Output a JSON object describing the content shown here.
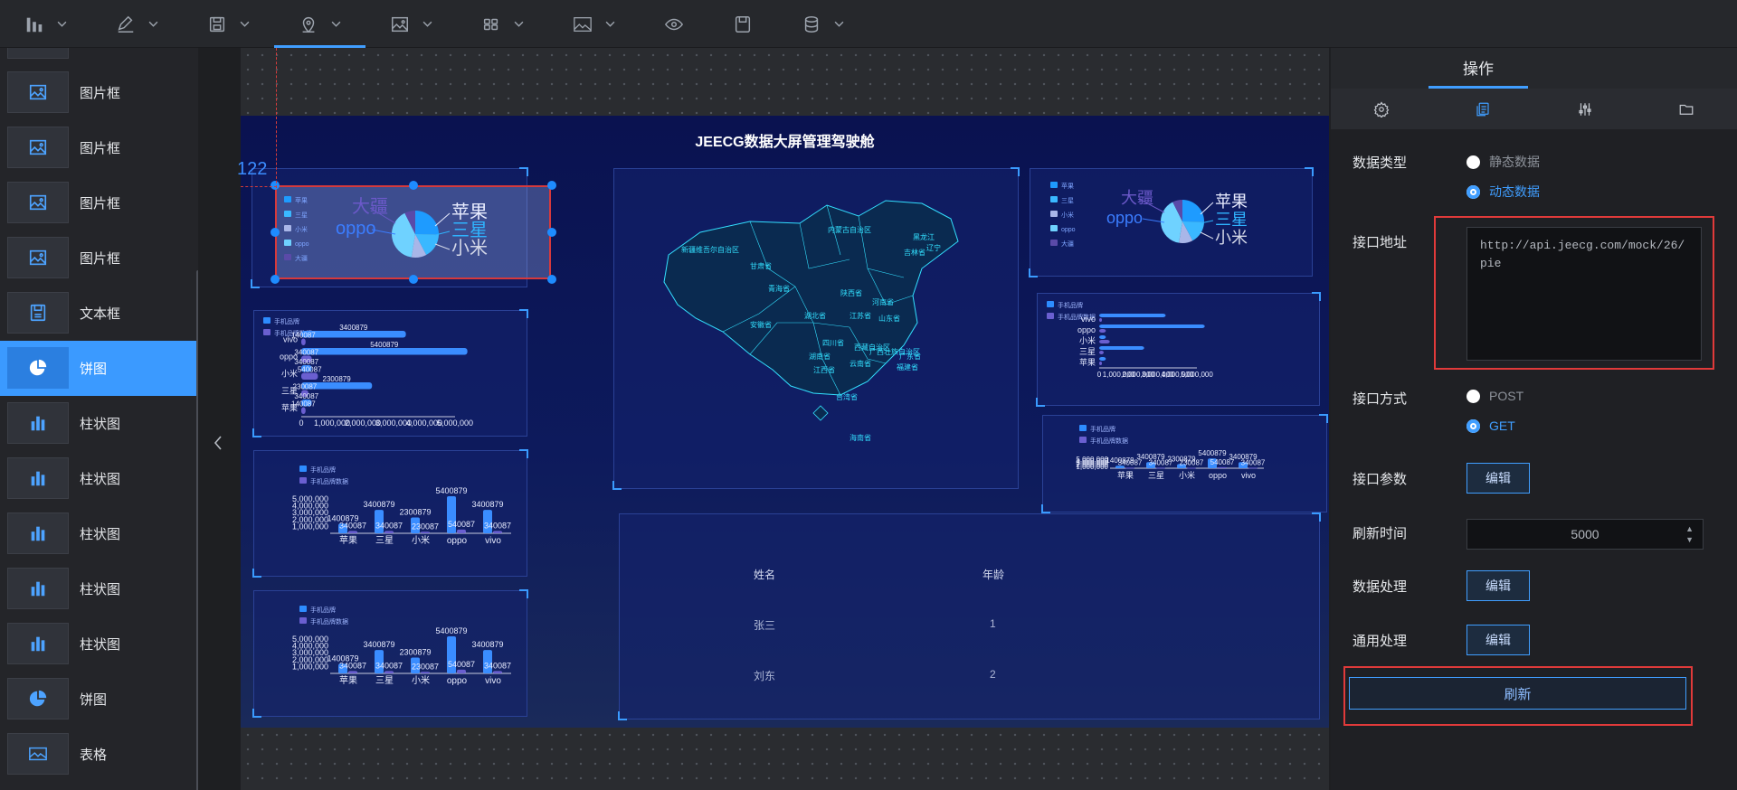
{
  "toolbar": {
    "items": [
      {
        "icon": "bar-chart-icon",
        "has_menu": true
      },
      {
        "icon": "pen-icon",
        "has_menu": true
      },
      {
        "icon": "save-icon",
        "has_menu": true
      },
      {
        "icon": "map-pin-icon",
        "has_menu": true,
        "active": true
      },
      {
        "icon": "image-icon",
        "has_menu": true
      },
      {
        "icon": "grid-icon",
        "has_menu": true
      },
      {
        "icon": "picture-icon",
        "has_menu": true
      },
      {
        "icon": "eye-icon",
        "has_menu": false
      },
      {
        "icon": "floppy-icon",
        "has_menu": false
      },
      {
        "icon": "database-icon",
        "has_menu": true
      }
    ]
  },
  "components": [
    {
      "label": "图片框",
      "icon": "image-icon"
    },
    {
      "label": "图片框",
      "icon": "image-icon"
    },
    {
      "label": "图片框",
      "icon": "image-icon"
    },
    {
      "label": "图片框",
      "icon": "image-icon"
    },
    {
      "label": "文本框",
      "icon": "text-box-icon"
    },
    {
      "label": "饼图",
      "icon": "pie-icon",
      "selected": true
    },
    {
      "label": "柱状图",
      "icon": "bar-icon"
    },
    {
      "label": "柱状图",
      "icon": "bar-icon"
    },
    {
      "label": "柱状图",
      "icon": "bar-icon"
    },
    {
      "label": "柱状图",
      "icon": "bar-icon"
    },
    {
      "label": "柱状图",
      "icon": "bar-icon"
    },
    {
      "label": "饼图",
      "icon": "pie-icon"
    },
    {
      "label": "表格",
      "icon": "table-icon"
    }
  ],
  "canvas": {
    "ruler_value": "122",
    "screen_title": "JEECG数据大屏管理驾驶舱",
    "pie_labels": [
      "苹果",
      "三星",
      "小米",
      "oppo",
      "大疆"
    ],
    "bar_legend": [
      "手机品牌",
      "手机品牌数据"
    ],
    "bar_categories": [
      "苹果",
      "三星",
      "小米",
      "oppo",
      "vivo"
    ],
    "table": {
      "columns": [
        "姓名",
        "年龄"
      ],
      "rows": [
        [
          "张三",
          "1"
        ],
        [
          "刘东",
          "2"
        ]
      ]
    },
    "map_regions": [
      "内蒙古自治区",
      "黑龙江",
      "吉林省",
      "辽宁",
      "新疆维吾尔自治区",
      "甘肃省",
      "青海省",
      "陕西省",
      "河南省",
      "山东省",
      "江苏省",
      "湖北省",
      "安徽省",
      "四川省",
      "西藏自治区",
      "湖南省",
      "江西省",
      "云南省",
      "广西壮族自治区",
      "广东省",
      "福建省",
      "台湾省",
      "海南省"
    ]
  },
  "chart_data": [
    {
      "type": "pie",
      "categories": [
        "苹果",
        "三星",
        "小米",
        "oppo",
        "大疆"
      ],
      "values": [
        3400879,
        2300879,
        1400879,
        5400879,
        1000879
      ],
      "legend": "left"
    },
    {
      "type": "bar",
      "orientation": "horizontal",
      "categories": [
        "苹果",
        "三星",
        "小米",
        "oppo",
        "vivo"
      ],
      "series": [
        {
          "name": "手机品牌",
          "values": [
            340087,
            2300879,
            340087,
            5400879,
            3400879
          ]
        },
        {
          "name": "手机品牌数据",
          "values": [
            140087,
            230087,
            540087,
            340087,
            140087
          ]
        }
      ],
      "xlim": [
        0,
        5000000
      ],
      "xticks": [
        "0",
        "1,000,000",
        "2,000,000",
        "3,000,000",
        "4,000,000",
        "5,000,000"
      ]
    },
    {
      "type": "bar",
      "categories": [
        "苹果",
        "三星",
        "小米",
        "oppo",
        "vivo"
      ],
      "series": [
        {
          "name": "手机品牌",
          "values": [
            1400879,
            3400879,
            2300879,
            5400879,
            3400879
          ]
        },
        {
          "name": "手机品牌数据",
          "values": [
            340087,
            340087,
            230087,
            540087,
            340087
          ]
        }
      ],
      "ylim": [
        0,
        5000000
      ],
      "yticks": [
        "1,000,000",
        "2,000,000",
        "3,000,000",
        "4,000,000",
        "5,000,000"
      ]
    }
  ],
  "panel": {
    "header": "操作",
    "tabs": [
      "settings-icon",
      "copy-icon",
      "sliders-icon",
      "folder-icon"
    ],
    "data_type_label": "数据类型",
    "data_type_options": [
      "静态数据",
      "动态数据"
    ],
    "api_url_label": "接口地址",
    "api_url": "http://api.jeecg.com/mock/26/pie",
    "method_label": "接口方式",
    "method_options": [
      "POST",
      "GET"
    ],
    "params_label": "接口参数",
    "edit_label": "编辑",
    "refresh_time_label": "刷新时间",
    "refresh_time": "5000",
    "data_process_label": "数据处理",
    "general_process_label": "通用处理",
    "refresh_button": "刷新"
  },
  "colors": {
    "accent": "#409eff",
    "highlight": "#e03a3a",
    "canvas_bg": "#0a1250"
  }
}
